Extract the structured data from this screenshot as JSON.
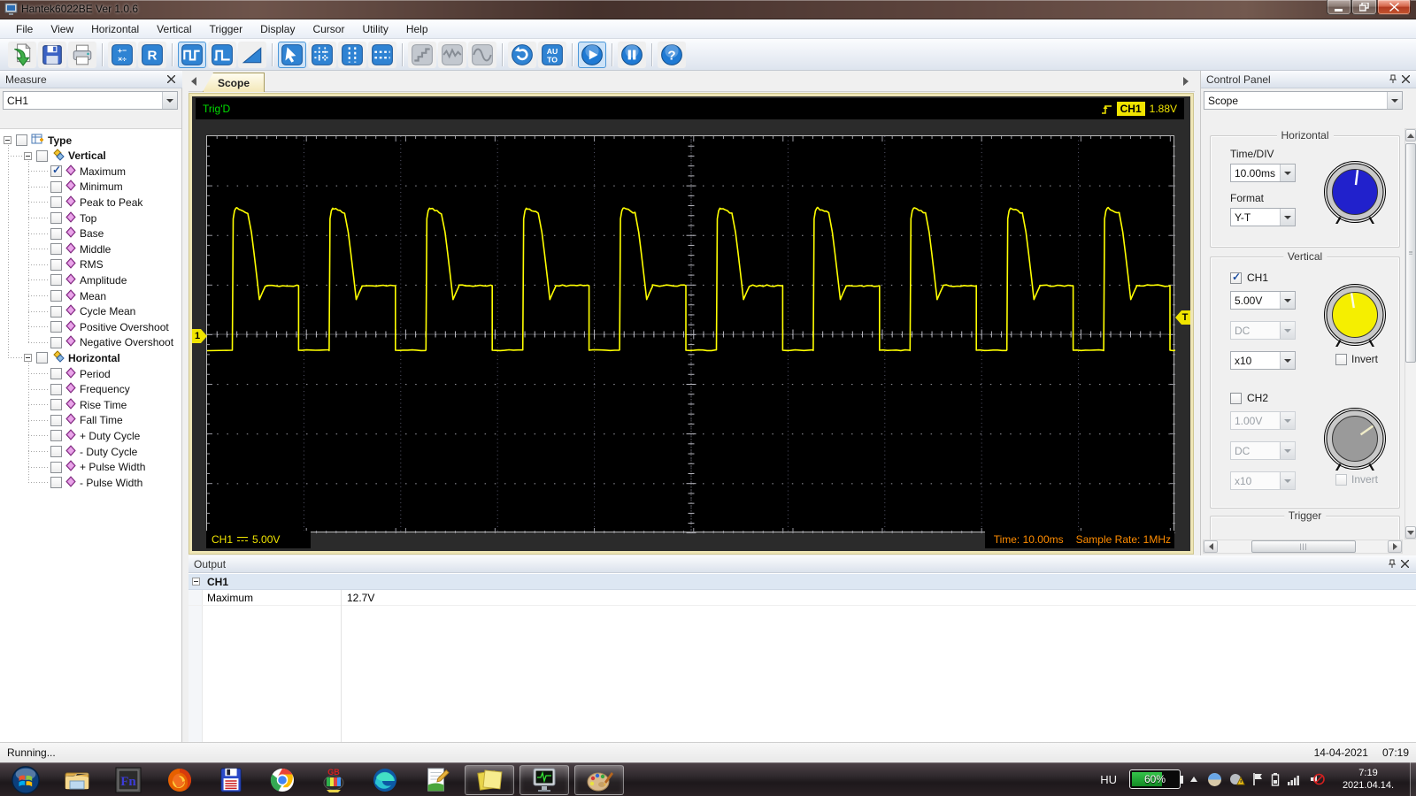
{
  "window": {
    "title": "Hantek6022BE Ver 1.0.6"
  },
  "menu_bar": {
    "items": [
      "File",
      "View",
      "Horizontal",
      "Vertical",
      "Trigger",
      "Display",
      "Cursor",
      "Utility",
      "Help"
    ]
  },
  "toolbar": {
    "buttons": [
      {
        "icon": "open-file-icon",
        "enabled": true,
        "selected": false,
        "group_end": false
      },
      {
        "icon": "save-icon",
        "enabled": true,
        "selected": false,
        "group_end": false
      },
      {
        "icon": "print-icon",
        "enabled": true,
        "selected": false,
        "group_end": true
      },
      {
        "icon": "math-icon",
        "label": "+− ×÷",
        "enabled": true,
        "selected": false,
        "group_end": false
      },
      {
        "icon": "reference-icon",
        "label": "R",
        "enabled": true,
        "selected": false,
        "group_end": true
      },
      {
        "icon": "square-wave-icon",
        "enabled": true,
        "selected": true,
        "group_end": false
      },
      {
        "icon": "pulse-wave-icon",
        "enabled": true,
        "selected": false,
        "group_end": false
      },
      {
        "icon": "ramp-icon",
        "enabled": true,
        "selected": false,
        "group_end": true
      },
      {
        "icon": "pointer-cursor-icon",
        "enabled": true,
        "selected": true,
        "group_end": false
      },
      {
        "icon": "cross-cursor-icon",
        "enabled": true,
        "selected": false,
        "group_end": false
      },
      {
        "icon": "vertical-cursor-icon",
        "enabled": true,
        "selected": false,
        "group_end": false
      },
      {
        "icon": "horizontal-cursor-icon",
        "enabled": true,
        "selected": false,
        "group_end": true
      },
      {
        "icon": "step-wave-icon",
        "enabled": false,
        "selected": false,
        "group_end": false
      },
      {
        "icon": "noise-wave-icon",
        "enabled": false,
        "selected": false,
        "group_end": false
      },
      {
        "icon": "sine-wave-icon",
        "enabled": false,
        "selected": false,
        "group_end": true
      },
      {
        "icon": "refresh-icon",
        "enabled": true,
        "selected": false,
        "group_end": false
      },
      {
        "icon": "auto-icon",
        "label": "AU TO",
        "enabled": true,
        "selected": false,
        "group_end": true
      },
      {
        "icon": "play-icon",
        "enabled": true,
        "selected": true,
        "group_end": true
      },
      {
        "icon": "pause-icon",
        "enabled": true,
        "selected": false,
        "group_end": true
      },
      {
        "icon": "help-icon",
        "label": "?",
        "enabled": true,
        "selected": false,
        "group_end": false
      }
    ]
  },
  "measure_panel": {
    "title": "Measure",
    "channel_select": "CH1",
    "tree": {
      "root_label": "Type",
      "groups": [
        {
          "label": "Vertical",
          "items": [
            {
              "label": "Maximum",
              "checked": true
            },
            {
              "label": "Minimum",
              "checked": false
            },
            {
              "label": "Peak to Peak",
              "checked": false
            },
            {
              "label": "Top",
              "checked": false
            },
            {
              "label": "Base",
              "checked": false
            },
            {
              "label": "Middle",
              "checked": false
            },
            {
              "label": "RMS",
              "checked": false
            },
            {
              "label": "Amplitude",
              "checked": false
            },
            {
              "label": "Mean",
              "checked": false
            },
            {
              "label": "Cycle Mean",
              "checked": false
            },
            {
              "label": "Positive Overshoot",
              "checked": false
            },
            {
              "label": "Negative Overshoot",
              "checked": false
            }
          ]
        },
        {
          "label": "Horizontal",
          "items": [
            {
              "label": "Period",
              "checked": false
            },
            {
              "label": "Frequency",
              "checked": false
            },
            {
              "label": "Rise Time",
              "checked": false
            },
            {
              "label": "Fall Time",
              "checked": false
            },
            {
              "label": "+ Duty Cycle",
              "checked": false
            },
            {
              "label": "- Duty Cycle",
              "checked": false
            },
            {
              "label": "+ Pulse Width",
              "checked": false
            },
            {
              "label": "- Pulse Width",
              "checked": false
            }
          ]
        }
      ]
    }
  },
  "scope": {
    "tab_label": "Scope",
    "trigger_status": "Trig'D",
    "trigger_readout_channel": "CH1",
    "trigger_readout_level": "1.88V",
    "left_marker": "1",
    "right_marker": "T",
    "bottom_left_channel": "CH1",
    "bottom_left_volts_div": "5.00V",
    "bottom_time": "Time: 10.00ms",
    "bottom_sample_rate": "Sample Rate: 1MHz"
  },
  "chart_data": {
    "type": "line",
    "title": "CH1 oscilloscope trace",
    "x_axis": {
      "time_per_div_ms": 10,
      "divisions": 10
    },
    "y_axis": {
      "volts_per_div": 5,
      "divisions": 8
    },
    "series": [
      {
        "name": "CH1",
        "color": "#ffff00",
        "period_ms": 10,
        "frequency_hz": 100,
        "baseline_v": -1.6,
        "peak_v": 12.7,
        "plateau_v": 4.9,
        "dip_v": 3.5,
        "first_edge_offset_div": 0.27,
        "peak_end_fraction": 0.16,
        "dip_fraction": 0.27,
        "plateau_start_fraction": 0.33,
        "fall_fraction": 0.675
      }
    ],
    "trigger_level_v": 1.88,
    "measured_maximum_v": 12.7
  },
  "control_panel": {
    "title": "Control Panel",
    "mode_select": "Scope",
    "horizontal": {
      "caption": "Horizontal",
      "time_div_label": "Time/DIV",
      "time_div_value": "10.00ms",
      "format_label": "Format",
      "format_value": "Y-T",
      "knob_color": "#2121cc"
    },
    "vertical": {
      "caption": "Vertical",
      "ch1": {
        "label": "CH1",
        "checked": true,
        "volts_value": "5.00V",
        "coupling_value": "DC",
        "probe_value": "x10",
        "invert_label": "Invert",
        "invert_checked": false,
        "knob_color": "#f5ef00"
      },
      "ch2": {
        "label": "CH2",
        "checked": false,
        "volts_value": "1.00V",
        "coupling_value": "DC",
        "probe_value": "x10",
        "invert_label": "Invert",
        "invert_checked": false,
        "knob_color": "#9a9a9a"
      }
    },
    "trigger": {
      "caption": "Trigger"
    }
  },
  "output_panel": {
    "title": "Output",
    "group_label": "CH1",
    "rows": [
      {
        "name": "Maximum",
        "value": "12.7V"
      }
    ]
  },
  "status_bar": {
    "left": "Running...",
    "date": "14-04-2021",
    "time": "07:19"
  },
  "taskbar": {
    "apps": [
      {
        "icon": "start-orb-icon",
        "active": false
      },
      {
        "icon": "explorer-icon",
        "active": false
      },
      {
        "icon": "fn-app-icon",
        "active": false
      },
      {
        "icon": "firefox-icon",
        "active": false
      },
      {
        "icon": "floppy-app-icon",
        "active": false
      },
      {
        "icon": "chrome-icon",
        "active": false
      },
      {
        "icon": "gb-app-icon",
        "active": false
      },
      {
        "icon": "edge-icon",
        "active": false
      },
      {
        "icon": "notepad-app-icon",
        "active": false
      },
      {
        "icon": "sticky-notes-icon",
        "active": true
      },
      {
        "icon": "oscilloscope-app-icon",
        "active": true
      },
      {
        "icon": "paint-icon",
        "active": true
      }
    ],
    "language": "HU",
    "battery_percent": "60%",
    "tray_icons": [
      "onedrive-icon",
      "action-center-icon",
      "flag-icon",
      "battery-icon",
      "network-icon",
      "volume-muted-icon"
    ],
    "clock_time": "7:19",
    "clock_date": "2021.04.14."
  }
}
